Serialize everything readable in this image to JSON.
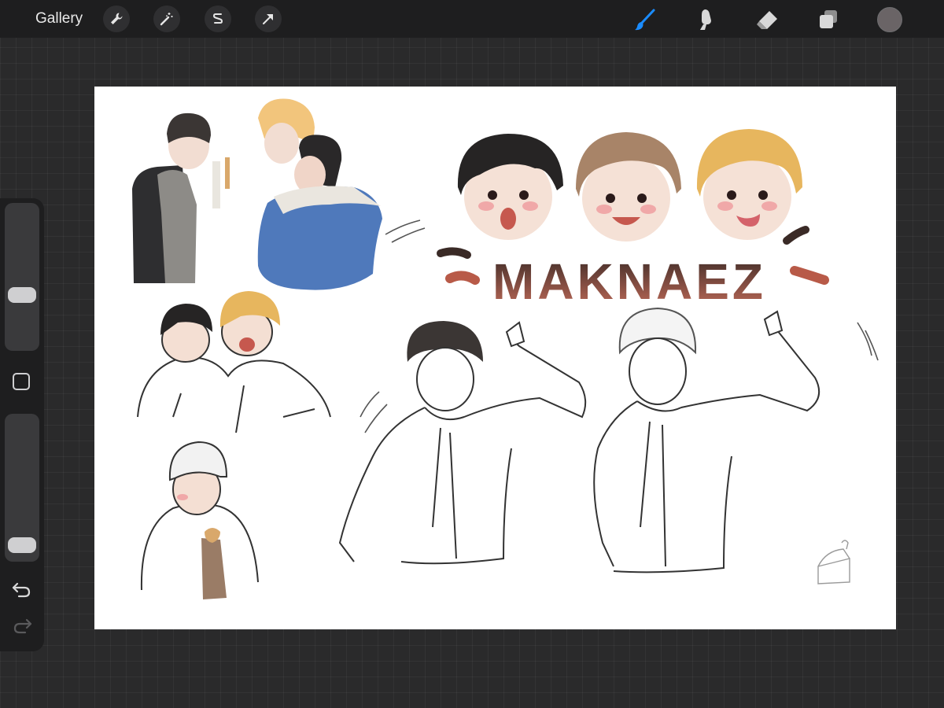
{
  "topbar": {
    "gallery_label": "Gallery",
    "left_tools": [
      {
        "icon": "wrench-icon",
        "name": "actions"
      },
      {
        "icon": "magic-wand-icon",
        "name": "adjustments"
      },
      {
        "icon": "selection-icon",
        "name": "selection"
      },
      {
        "icon": "transform-arrow-icon",
        "name": "transform"
      }
    ],
    "right_tools": [
      {
        "icon": "brush-icon",
        "name": "brush",
        "active": true
      },
      {
        "icon": "smudge-icon",
        "name": "smudge",
        "active": false
      },
      {
        "icon": "eraser-icon",
        "name": "eraser",
        "active": false
      },
      {
        "icon": "layers-icon",
        "name": "layers",
        "active": false
      }
    ],
    "current_color": "#6a6466",
    "accent_color": "#1a8cff"
  },
  "sidebar": {
    "brush_size_level": 0.35,
    "opacity_level": 0.03,
    "modify_button_icon": "square-icon",
    "undo_icon": "undo-arrow-icon",
    "redo_icon": "redo-arrow-icon"
  },
  "canvas": {
    "title_text": "MAKNAEZ",
    "title_gradient": [
      "#3a2a26",
      "#c06a58"
    ],
    "signature_icon": "cake-slice-icon"
  }
}
